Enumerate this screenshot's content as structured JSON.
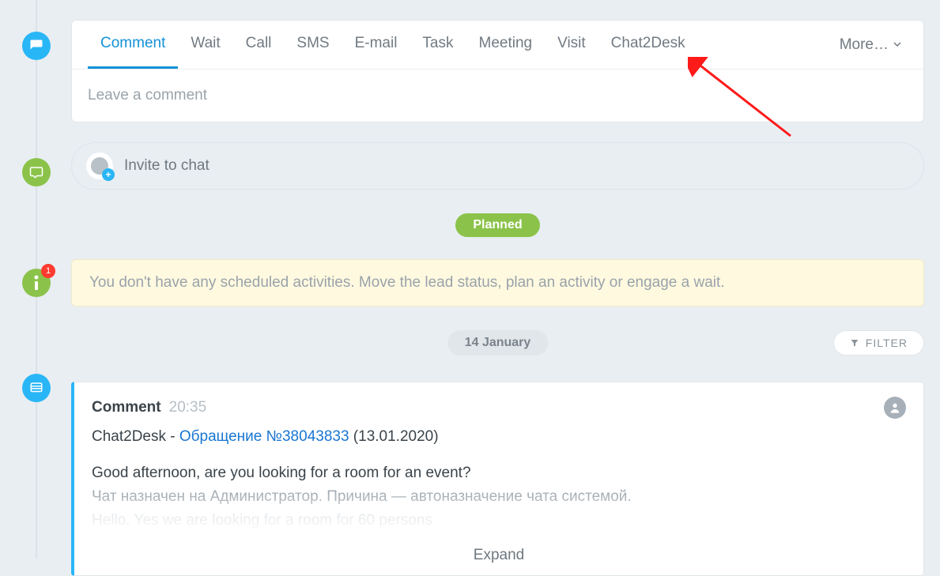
{
  "tabs": {
    "items": [
      "Comment",
      "Wait",
      "Call",
      "SMS",
      "E-mail",
      "Task",
      "Meeting",
      "Visit",
      "Chat2Desk"
    ],
    "more": "More…"
  },
  "comment_input_placeholder": "Leave a comment",
  "invite": {
    "label": "Invite to chat"
  },
  "planned_label": "Planned",
  "info_message": "You don't have any scheduled activities. Move the lead status, plan an activity or engage a wait.",
  "info_badge": "1",
  "date_label": "14 January",
  "filter_label": "FILTER",
  "entry": {
    "title": "Comment",
    "time": "20:35",
    "source_prefix": "Chat2Desk - ",
    "link_text": "Обращение №38043833",
    "source_suffix": " (13.01.2020)",
    "lines": [
      "Good afternoon, are you looking for a room for an event?",
      "Чат назначен на Администратор. Причина — автоназначение чата системой.",
      "Hello. Yes we are looking for a room for 60 persons"
    ],
    "expand": "Expand"
  }
}
